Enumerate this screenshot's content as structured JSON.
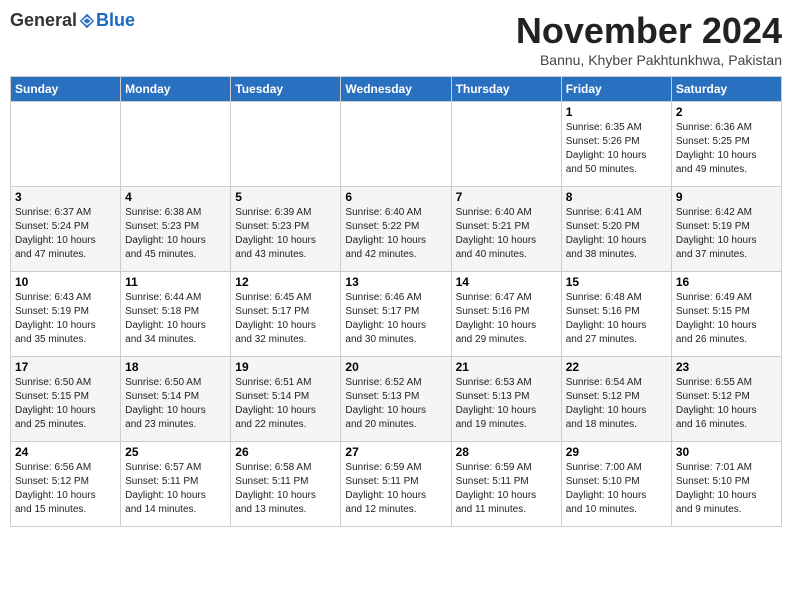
{
  "header": {
    "logo_general": "General",
    "logo_blue": "Blue",
    "month": "November 2024",
    "location": "Bannu, Khyber Pakhtunkhwa, Pakistan"
  },
  "weekdays": [
    "Sunday",
    "Monday",
    "Tuesday",
    "Wednesday",
    "Thursday",
    "Friday",
    "Saturday"
  ],
  "weeks": [
    [
      {
        "day": "",
        "info": ""
      },
      {
        "day": "",
        "info": ""
      },
      {
        "day": "",
        "info": ""
      },
      {
        "day": "",
        "info": ""
      },
      {
        "day": "",
        "info": ""
      },
      {
        "day": "1",
        "info": "Sunrise: 6:35 AM\nSunset: 5:26 PM\nDaylight: 10 hours\nand 50 minutes."
      },
      {
        "day": "2",
        "info": "Sunrise: 6:36 AM\nSunset: 5:25 PM\nDaylight: 10 hours\nand 49 minutes."
      }
    ],
    [
      {
        "day": "3",
        "info": "Sunrise: 6:37 AM\nSunset: 5:24 PM\nDaylight: 10 hours\nand 47 minutes."
      },
      {
        "day": "4",
        "info": "Sunrise: 6:38 AM\nSunset: 5:23 PM\nDaylight: 10 hours\nand 45 minutes."
      },
      {
        "day": "5",
        "info": "Sunrise: 6:39 AM\nSunset: 5:23 PM\nDaylight: 10 hours\nand 43 minutes."
      },
      {
        "day": "6",
        "info": "Sunrise: 6:40 AM\nSunset: 5:22 PM\nDaylight: 10 hours\nand 42 minutes."
      },
      {
        "day": "7",
        "info": "Sunrise: 6:40 AM\nSunset: 5:21 PM\nDaylight: 10 hours\nand 40 minutes."
      },
      {
        "day": "8",
        "info": "Sunrise: 6:41 AM\nSunset: 5:20 PM\nDaylight: 10 hours\nand 38 minutes."
      },
      {
        "day": "9",
        "info": "Sunrise: 6:42 AM\nSunset: 5:19 PM\nDaylight: 10 hours\nand 37 minutes."
      }
    ],
    [
      {
        "day": "10",
        "info": "Sunrise: 6:43 AM\nSunset: 5:19 PM\nDaylight: 10 hours\nand 35 minutes."
      },
      {
        "day": "11",
        "info": "Sunrise: 6:44 AM\nSunset: 5:18 PM\nDaylight: 10 hours\nand 34 minutes."
      },
      {
        "day": "12",
        "info": "Sunrise: 6:45 AM\nSunset: 5:17 PM\nDaylight: 10 hours\nand 32 minutes."
      },
      {
        "day": "13",
        "info": "Sunrise: 6:46 AM\nSunset: 5:17 PM\nDaylight: 10 hours\nand 30 minutes."
      },
      {
        "day": "14",
        "info": "Sunrise: 6:47 AM\nSunset: 5:16 PM\nDaylight: 10 hours\nand 29 minutes."
      },
      {
        "day": "15",
        "info": "Sunrise: 6:48 AM\nSunset: 5:16 PM\nDaylight: 10 hours\nand 27 minutes."
      },
      {
        "day": "16",
        "info": "Sunrise: 6:49 AM\nSunset: 5:15 PM\nDaylight: 10 hours\nand 26 minutes."
      }
    ],
    [
      {
        "day": "17",
        "info": "Sunrise: 6:50 AM\nSunset: 5:15 PM\nDaylight: 10 hours\nand 25 minutes."
      },
      {
        "day": "18",
        "info": "Sunrise: 6:50 AM\nSunset: 5:14 PM\nDaylight: 10 hours\nand 23 minutes."
      },
      {
        "day": "19",
        "info": "Sunrise: 6:51 AM\nSunset: 5:14 PM\nDaylight: 10 hours\nand 22 minutes."
      },
      {
        "day": "20",
        "info": "Sunrise: 6:52 AM\nSunset: 5:13 PM\nDaylight: 10 hours\nand 20 minutes."
      },
      {
        "day": "21",
        "info": "Sunrise: 6:53 AM\nSunset: 5:13 PM\nDaylight: 10 hours\nand 19 minutes."
      },
      {
        "day": "22",
        "info": "Sunrise: 6:54 AM\nSunset: 5:12 PM\nDaylight: 10 hours\nand 18 minutes."
      },
      {
        "day": "23",
        "info": "Sunrise: 6:55 AM\nSunset: 5:12 PM\nDaylight: 10 hours\nand 16 minutes."
      }
    ],
    [
      {
        "day": "24",
        "info": "Sunrise: 6:56 AM\nSunset: 5:12 PM\nDaylight: 10 hours\nand 15 minutes."
      },
      {
        "day": "25",
        "info": "Sunrise: 6:57 AM\nSunset: 5:11 PM\nDaylight: 10 hours\nand 14 minutes."
      },
      {
        "day": "26",
        "info": "Sunrise: 6:58 AM\nSunset: 5:11 PM\nDaylight: 10 hours\nand 13 minutes."
      },
      {
        "day": "27",
        "info": "Sunrise: 6:59 AM\nSunset: 5:11 PM\nDaylight: 10 hours\nand 12 minutes."
      },
      {
        "day": "28",
        "info": "Sunrise: 6:59 AM\nSunset: 5:11 PM\nDaylight: 10 hours\nand 11 minutes."
      },
      {
        "day": "29",
        "info": "Sunrise: 7:00 AM\nSunset: 5:10 PM\nDaylight: 10 hours\nand 10 minutes."
      },
      {
        "day": "30",
        "info": "Sunrise: 7:01 AM\nSunset: 5:10 PM\nDaylight: 10 hours\nand 9 minutes."
      }
    ]
  ]
}
